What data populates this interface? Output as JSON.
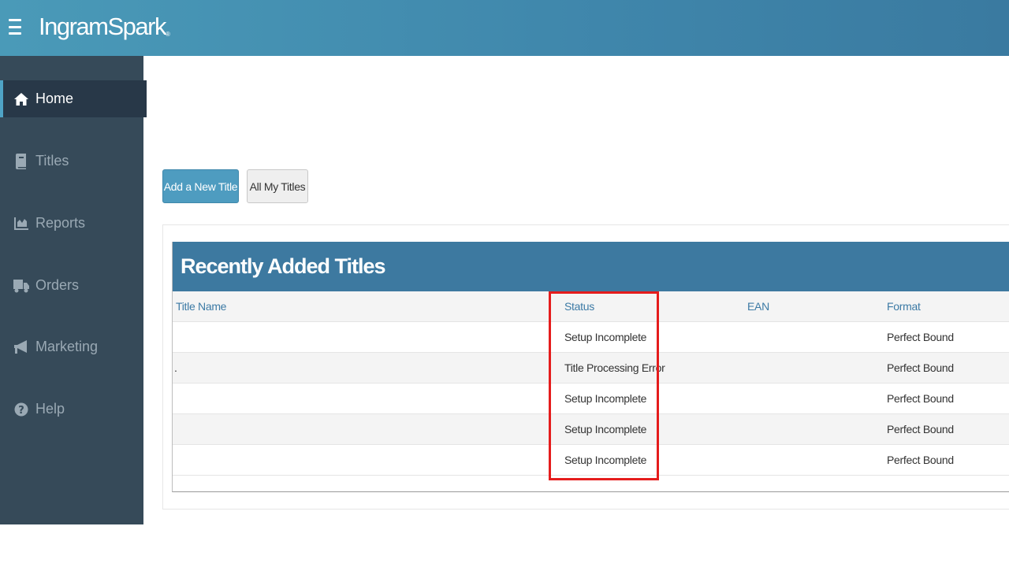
{
  "header": {
    "brand": "IngramSpark",
    "brand_mark": "®"
  },
  "sidebar": {
    "items": [
      {
        "label": "Home",
        "icon": "home-icon",
        "active": true
      },
      {
        "label": "Titles",
        "icon": "book-icon"
      },
      {
        "label": "Reports",
        "icon": "chart-icon"
      },
      {
        "label": "Orders",
        "icon": "truck-icon"
      },
      {
        "label": "Marketing",
        "icon": "megaphone-icon"
      },
      {
        "label": "Help",
        "icon": "question-icon"
      }
    ]
  },
  "actions": {
    "add_title": "Add a New Title",
    "all_titles": "All My Titles"
  },
  "table": {
    "title": "Recently Added Titles",
    "columns": [
      "Title Name",
      "Status",
      "EAN",
      "Format"
    ],
    "rows": [
      {
        "title": "",
        "status": "Setup Incomplete",
        "ean": "",
        "format": "Perfect Bound"
      },
      {
        "title": ".",
        "status": "Title Processing Error",
        "ean": "",
        "format": "Perfect Bound"
      },
      {
        "title": "",
        "status": "Setup Incomplete",
        "ean": "",
        "format": "Perfect Bound"
      },
      {
        "title": "",
        "status": "Setup Incomplete",
        "ean": "",
        "format": "Perfect Bound"
      },
      {
        "title": "",
        "status": "Setup Incomplete",
        "ean": "",
        "format": "Perfect Bound"
      }
    ]
  },
  "colors": {
    "header": "#4a9ab8",
    "sidebar": "#364a59",
    "table_header": "#3d79a0",
    "highlight": "#e51c1c"
  }
}
